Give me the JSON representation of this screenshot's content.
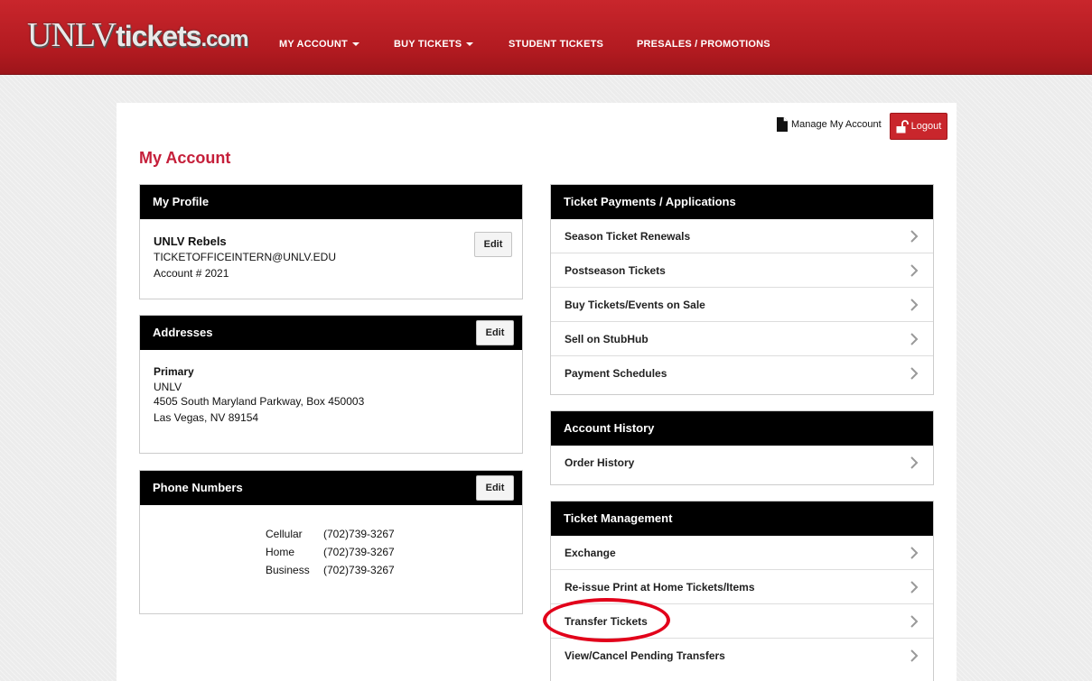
{
  "header": {
    "logo_part1": "UNLV",
    "logo_part2": "tickets",
    "logo_part3": ".com",
    "nav": [
      {
        "label": "MY ACCOUNT",
        "dropdown": true
      },
      {
        "label": "BUY TICKETS",
        "dropdown": true
      },
      {
        "label": "STUDENT TICKETS",
        "dropdown": false
      },
      {
        "label": "PRESALES / PROMOTIONS",
        "dropdown": false
      }
    ]
  },
  "top_actions": {
    "manage_label": "Manage My Account",
    "logout_label": "Logout"
  },
  "page_title": "My Account",
  "profile": {
    "heading": "My Profile",
    "name": "UNLV Rebels",
    "email": "TICKETOFFICEINTERN@UNLV.EDU",
    "account": "Account # 2021",
    "edit_label": "Edit"
  },
  "addresses": {
    "heading": "Addresses",
    "edit_label": "Edit",
    "type": "Primary",
    "line1": "UNLV",
    "line2": "4505 South Maryland Parkway, Box 450003",
    "line3": "Las Vegas, NV 89154"
  },
  "phones": {
    "heading": "Phone Numbers",
    "edit_label": "Edit",
    "items": [
      {
        "type": "Cellular",
        "number": "(702)739-3267"
      },
      {
        "type": "Home",
        "number": "(702)739-3267"
      },
      {
        "type": "Business",
        "number": "(702)739-3267"
      }
    ]
  },
  "payments": {
    "heading": "Ticket Payments / Applications",
    "items": [
      "Season Ticket Renewals",
      "Postseason Tickets",
      "Buy Tickets/Events on Sale",
      "Sell on StubHub",
      "Payment Schedules"
    ]
  },
  "history": {
    "heading": "Account History",
    "items": [
      "Order History"
    ]
  },
  "management": {
    "heading": "Ticket Management",
    "items": [
      "Exchange",
      "Re-issue Print at Home Tickets/Items",
      "Transfer Tickets",
      "View/Cancel Pending Transfers"
    ]
  },
  "colors": {
    "brand_red": "#c9262c",
    "title_red": "#c51f3a",
    "annotation_red": "#e2001a"
  }
}
